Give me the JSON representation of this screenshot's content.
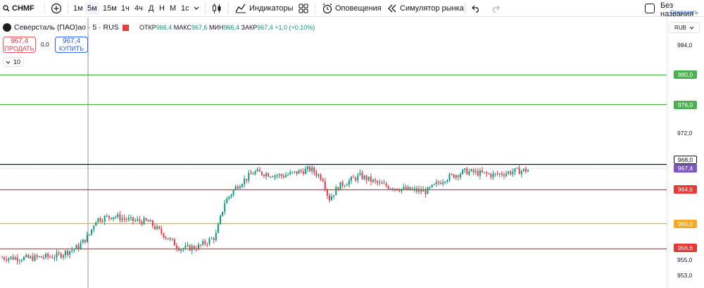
{
  "toolbar": {
    "symbol": "CHMF",
    "intervals": [
      "1м",
      "5м",
      "15м",
      "1ч",
      "4ч",
      "Д",
      "Н",
      "М",
      "1с"
    ],
    "indicators": "Индикаторы",
    "alerts": "Оповещения",
    "replay": "Симулятор рынка",
    "layout_title": "Без названия",
    "save": "Сохранить"
  },
  "legend": {
    "title": "Северсталь (ПАО)ао · 5 · RUS",
    "o_label": "ОТКР",
    "o_value": "966,4",
    "h_label": "МАКС",
    "h_value": "967,6",
    "l_label": "МИН",
    "l_value": "966,4",
    "c_label": "ЗАКР",
    "c_value": "967,4",
    "change": "+1,0 (+0,10%)"
  },
  "trade": {
    "sell_price": "967,4",
    "sell_label": "ПРОДАТЬ",
    "spread": "0,0",
    "buy_price": "967,4",
    "buy_label": "КУПИТЬ",
    "volume": "10"
  },
  "currency": "RUB",
  "colors": {
    "up": "#089981",
    "down": "#f23645",
    "green_level": "#4caf50",
    "red_level": "#e53935",
    "orange_level": "#f9a825",
    "price_tag": "#7e57c2"
  },
  "axis_ticks": [
    "984,0",
    "972,0",
    "955,0",
    "953,0"
  ],
  "levels": [
    {
      "price": "980,0",
      "color": "#4caf50",
      "value": 980.0
    },
    {
      "price": "976,0",
      "color": "#4caf50",
      "value": 976.0
    },
    {
      "price": "968,0",
      "color": "#131722",
      "value": 968.0
    },
    {
      "price": "964,6",
      "color": "#e53935",
      "value": 964.6
    },
    {
      "price": "960,0",
      "color": "#f9a825",
      "value": 960.0
    },
    {
      "price": "956,6",
      "color": "#e53935",
      "value": 956.6
    }
  ],
  "last_price": "967,4"
}
